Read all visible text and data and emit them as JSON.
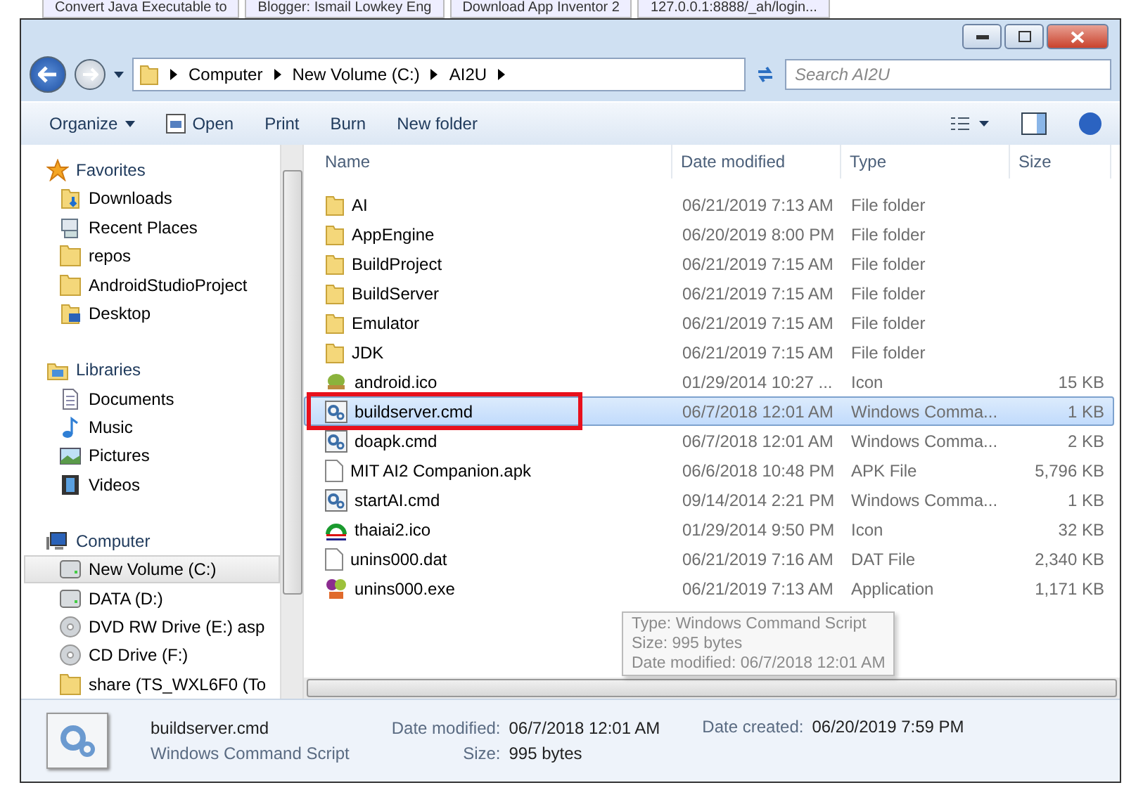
{
  "browser_tabs": [
    "Convert Java Executable to",
    "Blogger: Ismail Lowkey Eng",
    "Download App Inventor 2",
    "127.0.0.1:8888/_ah/login..."
  ],
  "address": {
    "crumbs": [
      "Computer",
      "New Volume (C:)",
      "AI2U"
    ]
  },
  "search": {
    "placeholder": "Search AI2U"
  },
  "toolbar": [
    {
      "label": "Organize",
      "kind": "menu"
    },
    {
      "label": "Open",
      "kind": "open"
    },
    {
      "label": "Print",
      "kind": "plain"
    },
    {
      "label": "Burn",
      "kind": "plain"
    },
    {
      "label": "New folder",
      "kind": "plain"
    }
  ],
  "sidebar": {
    "groups": [
      {
        "label": "Favorites",
        "kind": "star",
        "items": [
          {
            "label": "Downloads",
            "kind": "downloads",
            "selected": false
          },
          {
            "label": "Recent Places",
            "kind": "recent",
            "selected": false
          },
          {
            "label": "repos",
            "kind": "folder",
            "selected": false
          },
          {
            "label": "AndroidStudioProject",
            "kind": "folder",
            "selected": false
          },
          {
            "label": "Desktop",
            "kind": "desktop",
            "selected": false
          }
        ]
      },
      {
        "label": "Libraries",
        "kind": "libraries",
        "items": [
          {
            "label": "Documents",
            "kind": "doc",
            "selected": false
          },
          {
            "label": "Music",
            "kind": "music",
            "selected": false
          },
          {
            "label": "Pictures",
            "kind": "pictures",
            "selected": false
          },
          {
            "label": "Videos",
            "kind": "videos",
            "selected": false
          }
        ]
      },
      {
        "label": "Computer",
        "kind": "computer",
        "items": [
          {
            "label": "New Volume (C:)",
            "kind": "drive",
            "selected": true
          },
          {
            "label": "DATA (D:)",
            "kind": "drive",
            "selected": false
          },
          {
            "label": "DVD RW Drive (E:) asp",
            "kind": "disc",
            "selected": false
          },
          {
            "label": "CD Drive (F:)",
            "kind": "disc",
            "selected": false
          },
          {
            "label": "share (TS_WXL6F0 (To",
            "kind": "folder",
            "selected": false
          }
        ]
      }
    ]
  },
  "table": {
    "columns": [
      "Name",
      "Date modified",
      "Type",
      "Size"
    ],
    "rows": [
      {
        "name": "AI",
        "date": "06/21/2019 7:13 AM",
        "type": "File folder",
        "size": "",
        "kind": "folder",
        "selected": false,
        "outlined": false
      },
      {
        "name": "AppEngine",
        "date": "06/20/2019 8:00 PM",
        "type": "File folder",
        "size": "",
        "kind": "folder",
        "selected": false,
        "outlined": false
      },
      {
        "name": "BuildProject",
        "date": "06/21/2019 7:15 AM",
        "type": "File folder",
        "size": "",
        "kind": "folder",
        "selected": false,
        "outlined": false
      },
      {
        "name": "BuildServer",
        "date": "06/21/2019 7:15 AM",
        "type": "File folder",
        "size": "",
        "kind": "folder",
        "selected": false,
        "outlined": false
      },
      {
        "name": "Emulator",
        "date": "06/21/2019 7:15 AM",
        "type": "File folder",
        "size": "",
        "kind": "folder",
        "selected": false,
        "outlined": false
      },
      {
        "name": "JDK",
        "date": "06/21/2019 7:15 AM",
        "type": "File folder",
        "size": "",
        "kind": "folder",
        "selected": false,
        "outlined": false
      },
      {
        "name": "android.ico",
        "date": "01/29/2014 10:27 ...",
        "type": "Icon",
        "size": "15 KB",
        "kind": "ico",
        "selected": false,
        "outlined": false
      },
      {
        "name": "buildserver.cmd",
        "date": "06/7/2018 12:01 AM",
        "type": "Windows Comma...",
        "size": "1 KB",
        "kind": "cmd",
        "selected": true,
        "outlined": true
      },
      {
        "name": "doapk.cmd",
        "date": "06/7/2018 12:01 AM",
        "type": "Windows Comma...",
        "size": "2 KB",
        "kind": "cmd",
        "selected": false,
        "outlined": false
      },
      {
        "name": "MIT AI2 Companion.apk",
        "date": "06/6/2018 10:48 PM",
        "type": "APK File",
        "size": "5,796 KB",
        "kind": "file",
        "selected": false,
        "outlined": false
      },
      {
        "name": "startAI.cmd",
        "date": "09/14/2014 2:21 PM",
        "type": "Windows Comma...",
        "size": "1 KB",
        "kind": "cmd",
        "selected": false,
        "outlined": false
      },
      {
        "name": "thaiai2.ico",
        "date": "01/29/2014 9:50 PM",
        "type": "Icon",
        "size": "32 KB",
        "kind": "ico2",
        "selected": false,
        "outlined": false
      },
      {
        "name": "unins000.dat",
        "date": "06/21/2019 7:16 AM",
        "type": "DAT File",
        "size": "2,340 KB",
        "kind": "file",
        "selected": false,
        "outlined": false
      },
      {
        "name": "unins000.exe",
        "date": "06/21/2019 7:13 AM",
        "type": "Application",
        "size": "1,171 KB",
        "kind": "exe",
        "selected": false,
        "outlined": false
      }
    ]
  },
  "tooltip": [
    "Type: Windows Command Script",
    "Size: 995 bytes",
    "Date modified: 06/7/2018 12:01 AM"
  ],
  "details": {
    "name": "buildserver.cmd",
    "type": "Windows Command Script",
    "fields": [
      {
        "label": "Date modified:",
        "value": "06/7/2018 12:01 AM"
      },
      {
        "label": "Date created:",
        "value": "06/20/2019 7:59 PM"
      },
      {
        "label": "Size:",
        "value": "995 bytes"
      }
    ]
  }
}
